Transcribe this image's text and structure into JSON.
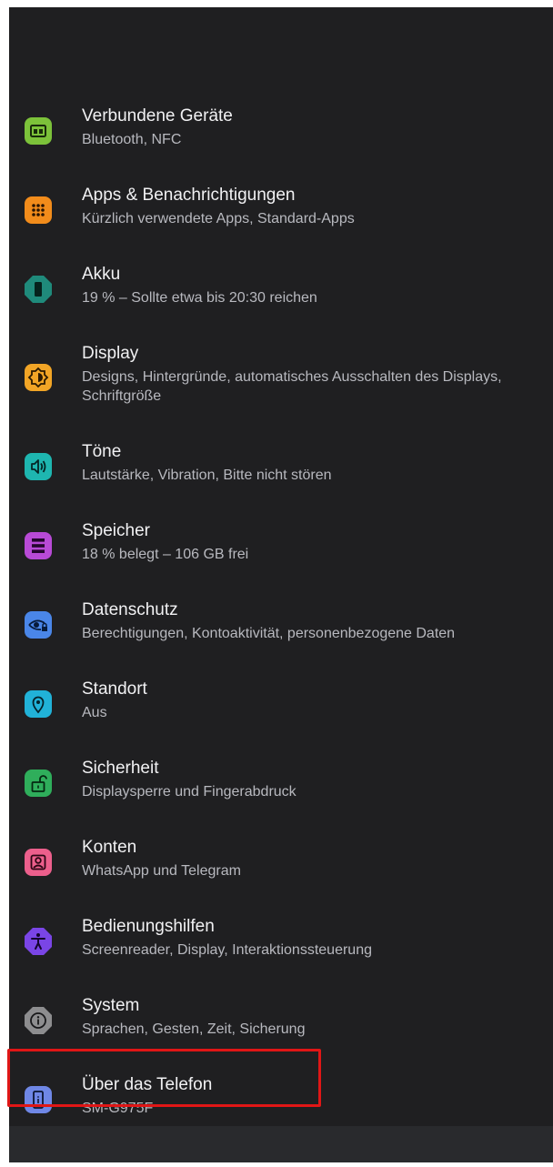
{
  "settings": {
    "items": [
      {
        "title": "Verbundene Geräte",
        "subtitle": "Bluetooth, NFC"
      },
      {
        "title": "Apps & Benachrichtigungen",
        "subtitle": "Kürzlich verwendete Apps, Standard-Apps"
      },
      {
        "title": "Akku",
        "subtitle": "19 % – Sollte etwa bis 20:30 reichen"
      },
      {
        "title": "Display",
        "subtitle": "Designs, Hintergründe, automatisches Ausschalten des Displays, Schriftgröße"
      },
      {
        "title": "Töne",
        "subtitle": "Lautstärke, Vibration, Bitte nicht stören"
      },
      {
        "title": "Speicher",
        "subtitle": "18 % belegt – 106 GB frei"
      },
      {
        "title": "Datenschutz",
        "subtitle": "Berechtigungen, Kontoaktivität, personenbezogene Daten"
      },
      {
        "title": "Standort",
        "subtitle": "Aus"
      },
      {
        "title": "Sicherheit",
        "subtitle": "Displaysperre und Fingerabdruck"
      },
      {
        "title": "Konten",
        "subtitle": "WhatsApp und Telegram"
      },
      {
        "title": "Bedienungshilfen",
        "subtitle": "Screenreader, Display, Interaktionssteuerung"
      },
      {
        "title": "System",
        "subtitle": "Sprachen, Gesten, Zeit, Sicherung"
      },
      {
        "title": "Über das Telefon",
        "subtitle": "SM-G975F"
      }
    ]
  },
  "icons": {
    "connected_devices": {
      "name": "devices-icon",
      "color": "#7cc23a"
    },
    "apps": {
      "name": "apps-grid-icon",
      "color": "#f28c1b"
    },
    "battery": {
      "name": "battery-icon",
      "color": "#1f8a7b"
    },
    "display": {
      "name": "brightness-icon",
      "color": "#f2a526"
    },
    "sound": {
      "name": "volume-icon",
      "color": "#1eb6b0"
    },
    "storage": {
      "name": "storage-icon",
      "color": "#b84ad6"
    },
    "privacy": {
      "name": "privacy-eye-icon",
      "color": "#4a86e8"
    },
    "location": {
      "name": "location-pin-icon",
      "color": "#21b2d8"
    },
    "security": {
      "name": "unlock-icon",
      "color": "#2fae5b"
    },
    "accounts": {
      "name": "account-icon",
      "color": "#ec5f8c"
    },
    "accessibility": {
      "name": "accessibility-icon",
      "color": "#7a45e6"
    },
    "system": {
      "name": "info-icon",
      "color": "#8d8d8f"
    },
    "about_phone": {
      "name": "phone-icon",
      "color": "#6f87e6"
    }
  },
  "colors": {
    "background": "#1f1f21",
    "title_text": "#f1f1f3",
    "subtitle_text": "#b8b9bf",
    "highlight_border": "#e01616",
    "bottom_bar": "#292a2d"
  }
}
